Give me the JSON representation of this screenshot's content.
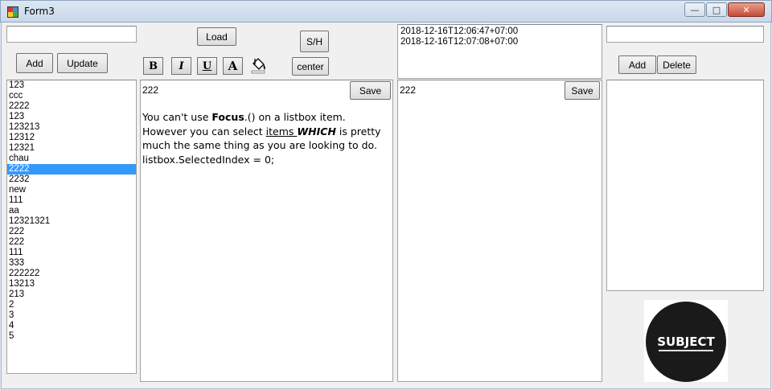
{
  "window": {
    "title": "Form3"
  },
  "left": {
    "input_value": "",
    "add_label": "Add",
    "update_label": "Update",
    "items": [
      "123",
      "ccc",
      "2222",
      "123",
      "123213",
      "12312",
      "12321",
      "chau",
      "2222",
      "2232",
      "new",
      "111",
      "aa",
      "12321321",
      "222",
      "222",
      "111",
      "333",
      "222222",
      "13213",
      "213",
      "2",
      "3",
      "4",
      "5"
    ],
    "selected_index": 8
  },
  "toolbar": {
    "load_label": "Load",
    "sh_label": "S/H",
    "center_label": "center",
    "bold_glyph": "B",
    "italic_glyph": "I",
    "underline_glyph": "U",
    "font_glyph": "A"
  },
  "editor": {
    "title_value": "222",
    "save_label": "Save",
    "body": {
      "s1": "You can't use ",
      "focus": "Focus",
      "s2": ".() on a listbox item. However you can select ",
      "items": "items ",
      "which": "WHICH",
      "s3": " is pretty much the same thing as you are looking to do.",
      "line2": "listbox.SelectedIndex = 0;"
    }
  },
  "timestamps": [
    "2018-12-16T12:06:47+07:00",
    "2018-12-16T12:07:08+07:00"
  ],
  "detail": {
    "title_value": "222",
    "save_label": "Save"
  },
  "right": {
    "input_value": "",
    "add_label": "Add",
    "delete_label": "Delete",
    "logo_text": "SUBJECT"
  }
}
